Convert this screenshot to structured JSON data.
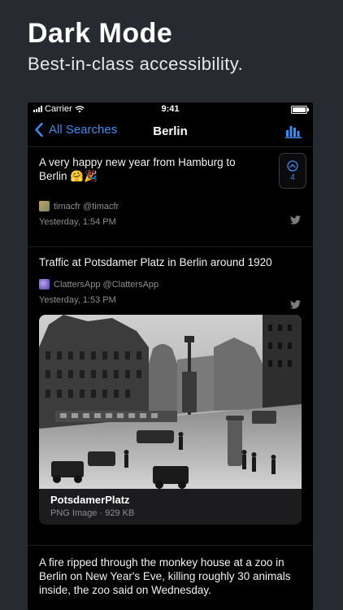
{
  "promo": {
    "title": "Dark Mode",
    "subtitle": "Best-in-class accessibility."
  },
  "status_bar": {
    "carrier": "Carrier",
    "time": "9:41"
  },
  "nav": {
    "back_label": "All Searches",
    "title": "Berlin"
  },
  "unread_badge": {
    "count": "4"
  },
  "tweets": [
    {
      "text": "A very happy new year from Hamburg to Berlin 🤗🎉",
      "author": "timacfr @timacfr",
      "date": "Yesterday, 1:54 PM"
    },
    {
      "text": "Traffic at Potsdamer Platz in Berlin around 1920",
      "author": "ClattersApp @ClattersApp",
      "date": "Yesterday, 1:53 PM",
      "attachment": {
        "name": "PotsdamerPlatz",
        "info": "PNG Image · 929 KB"
      }
    },
    {
      "text": "A fire ripped through the monkey house at a zoo in Berlin on New Year's Eve, killing roughly 30 animals inside, the zoo said on Wednesday."
    }
  ],
  "icons": {
    "back": "chevron-left-icon",
    "chart": "bar-chart-icon",
    "badge": "chevron-up-circle-icon",
    "twitter": "twitter-bird-icon",
    "wifi": "wifi-icon",
    "signal": "signal-bars-icon",
    "battery": "battery-icon"
  },
  "colors": {
    "accent": "#3b8cf5",
    "background": "#272a31",
    "phone_bg": "#000000",
    "secondary_text": "#8e8e93"
  }
}
